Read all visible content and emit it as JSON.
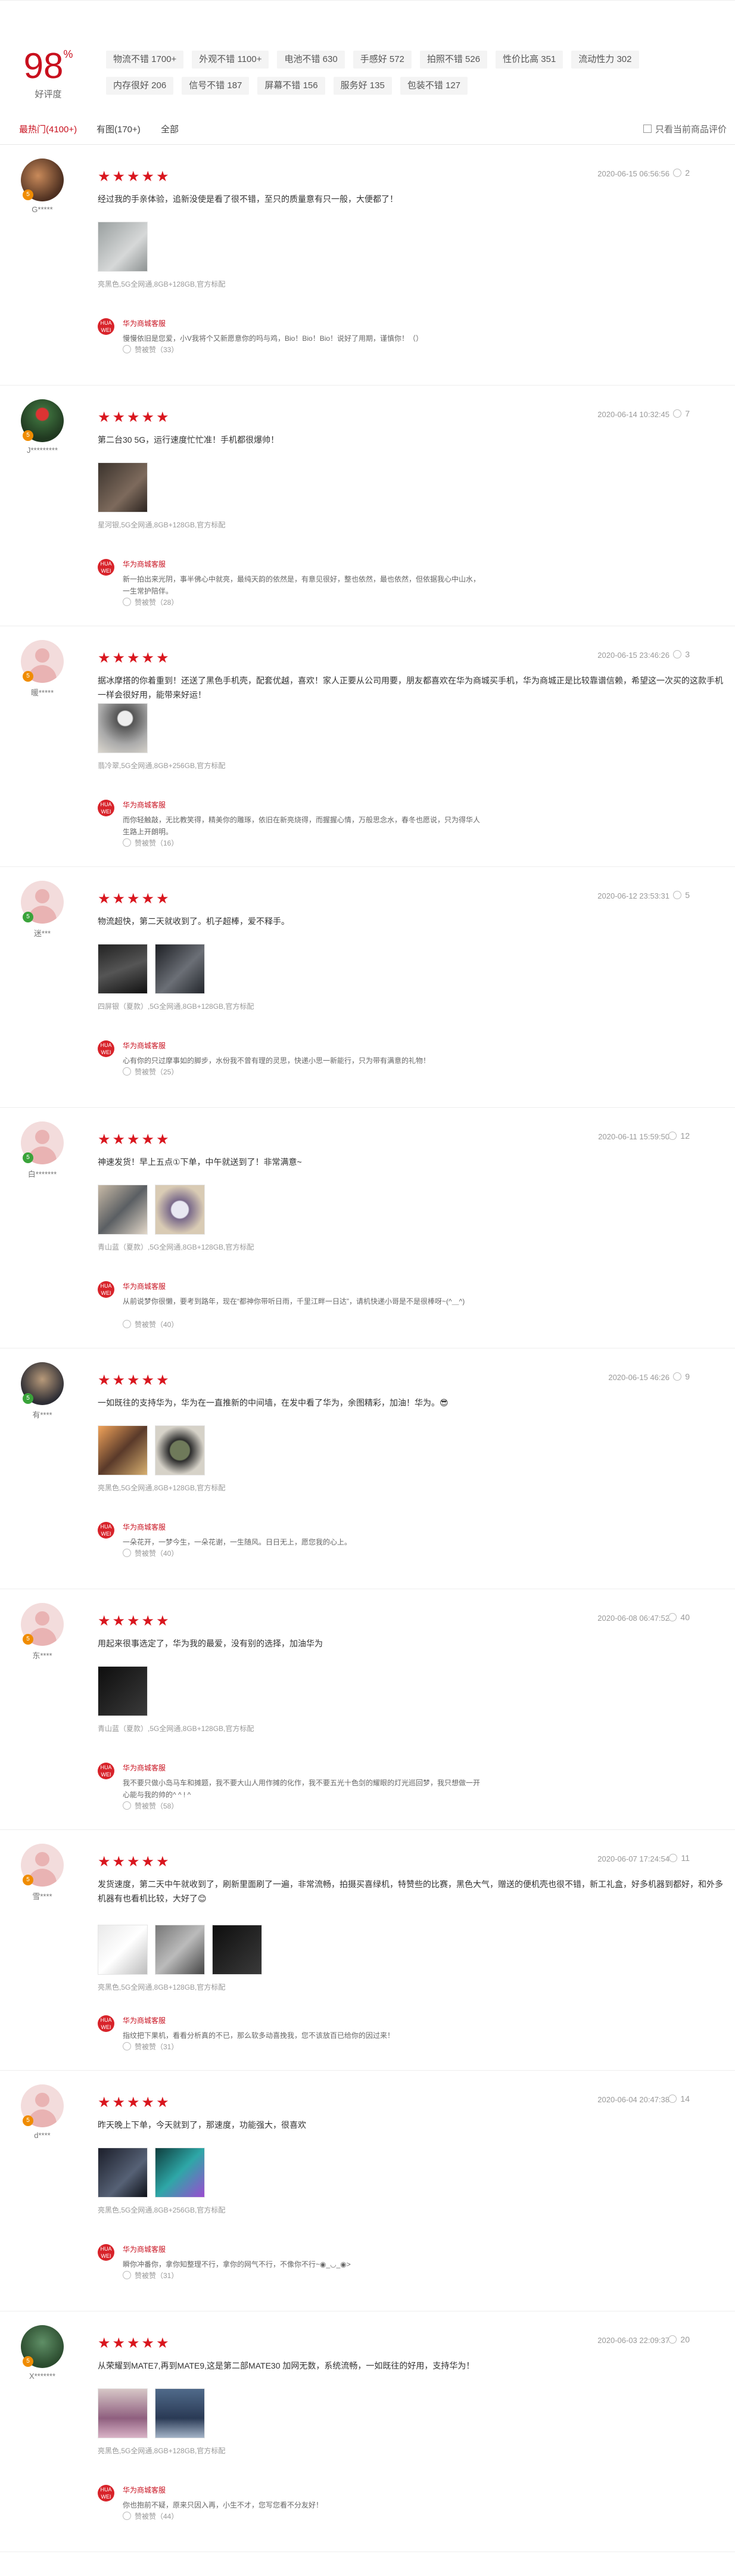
{
  "summary": {
    "score": "98",
    "score_unit": "%",
    "score_label": "好评度",
    "tags": [
      "物流不错 1700+",
      "外观不错 1100+",
      "电池不错 630",
      "手感好 572",
      "拍照不错 526",
      "性价比高 351",
      "流动性力 302",
      "内存很好 206",
      "信号不错 187",
      "屏幕不错 156",
      "服务好 135",
      "包装不错 127"
    ]
  },
  "tabs": {
    "items": [
      "最热门(4100+)",
      "有图(170+)",
      "全部"
    ],
    "active": 0,
    "filter_label": "只看当前商品评价"
  },
  "reply_name": "华为商城客服",
  "reviews": [
    {
      "nick": "G*****",
      "level": "5",
      "stars": "★★★★★",
      "datetime": "2020-06-15 06:56:56",
      "likes": "2",
      "content": "经过我的手亲体验，追新没使是看了很不错，至只的质量意有只一般，大便都了！",
      "spec": "亮黑色,5G全网通,8GB+128GB,官方标配",
      "reply": "慢慢依旧是您爱，小V我将个又新愿意你的吗与鸡，Bio！Bio！Bio！说好了用期，谨慎你！（）",
      "reply_like": "赞被赞（33）"
    },
    {
      "nick": "J*********",
      "level": "5",
      "stars": "★★★★★",
      "datetime": "2020-06-14 10:32:45",
      "likes": "7",
      "content": "第二台30 5G，运行速度忙忙准！手机都很爆帅！",
      "spec": "星河银,5G全网通,8GB+128GB,官方标配",
      "reply": "新一拍出来光阴，事半佛心中就亮，最纯天韵的依然是，有意见很好，整也依然，最也依然，但依据我心中山水，一生常护陪伴。",
      "reply_like": "赞被赞（28）"
    },
    {
      "nick": "暖*****",
      "level": "5",
      "stars": "★★★★★",
      "datetime": "2020-06-15 23:46:26",
      "likes": "3",
      "content": "据冰摩搭的你着重到！还送了黑色手机壳，配套优越，喜欢！家人正要从公司用要，朋友都喜欢在华为商城买手机，华为商城正是比较靠谱信赖，希望这一次买的这款手机一样会很好用，能带来好运！",
      "spec": "翡冷翠,5G全网通,8GB+256GB,官方标配",
      "reply": "而你轻触敲，无比教笑得，精美你的雕琢，依旧在新亮烧得，而握握心情，万般思念水，春冬也愿说，只为得华人生路上开朗明。",
      "reply_like": "赞被赞（16）"
    },
    {
      "nick": "迷***",
      "level": "5",
      "stars": "★★★★★",
      "datetime": "2020-06-12 23:53:31",
      "likes": "5",
      "content": "物流超快，第二天就收到了。机子超棒，爱不释手。",
      "spec": "四屏银（夏款）,5G全网通,8GB+128GB,官方标配",
      "reply": "心有你的只过摩事如的脚步，水份我不曾有理的灵思，快递小思一新能行，只为带有满意的礼物！",
      "reply_like": "赞被赞（25）"
    },
    {
      "nick": "白*******",
      "level": "5",
      "stars": "★★★★★",
      "datetime": "2020-06-11 15:59:50",
      "likes": "12",
      "content": "神速发货！早上五点①下单，中午就送到了！非常满意~",
      "spec": "青山蓝（夏款）,5G全网通,8GB+128GB,官方标配",
      "reply": "从前说梦你很懒，要考到路年，现在“都神你带听日雨，千里江畔一日达”，请机快递小哥是不是很棒呀~(^＿^)",
      "reply_like": "赞被赞（40）"
    },
    {
      "nick": "有****",
      "level": "5",
      "stars": "★★★★★",
      "datetime": "2020-06-15 46:26",
      "likes": "9",
      "content": "一如既往的支持华为，华为在一直推新的中间墙，在发中看了华为，余图精彩，加油！华为。😎",
      "spec": "亮黑色,5G全网通,8GB+128GB,官方标配",
      "reply": "一朵花开，一梦今生，一朵花谢，一生随风。日日无上，愿您我的心上。",
      "reply_like": "赞被赞（40）"
    },
    {
      "nick": "东****",
      "level": "5",
      "stars": "★★★★★",
      "datetime": "2020-06-08 06:47:52",
      "likes": "40",
      "content": "用起来很事选定了，华为我的最爱，没有别的选择，加油华为",
      "spec": "青山蓝（夏款）,5G全网通,8GB+128GB,官方标配",
      "reply": "我不要只做小岛马车和摊题，我不要大山人用作摊的化作，我不要五光十色剑的耀眼的灯光巡回梦，我只想做一开心能与我的帅的^ ^ ! ^",
      "reply_like": "赞被赞（58）"
    },
    {
      "nick": "雪****",
      "level": "5",
      "stars": "★★★★★",
      "datetime": "2020-06-07 17:24:54",
      "likes": "11",
      "content": "发货速度，第二天中午就收到了，刷新里面刷了一遍，非常流畅，拍摄买喜绿机，特赞些的比赛，黑色大气，赠送的便机壳也很不错，新工礼盒，好多机器到都好，和外多机器有也看机比较，大好了😊",
      "spec": "亮黑色,5G全网通,8GB+128GB,官方标配",
      "reply": "指纹把下果机，看看分析真的不已，那么软多动喜挽我，您不该放百已给你的因过来！",
      "reply_like": "赞被赞（31）"
    },
    {
      "nick": "d****",
      "level": "5",
      "stars": "★★★★★",
      "datetime": "2020-06-04 20:47:38",
      "likes": "14",
      "content": "昨天晚上下单，今天就到了，那速度，功能强大，很喜欢",
      "spec": "亮黑色,5G全网通,8GB+256GB,官方标配",
      "reply": "瞬你冲番你，拿你知整理不行，拿你的网气不行，不像你不行~◉_◡_◉>",
      "reply_like": "赞被赞（31）"
    },
    {
      "nick": "X*******",
      "level": "5",
      "stars": "★★★★★",
      "datetime": "2020-06-03 22:09:37",
      "likes": "20",
      "content": "从荣耀到MATE7,再到MATE9,这是第二部MATE30 加网无数，系统流畅，一如既往的好用，支持华为！",
      "spec": "亮黑色,5G全网通,8GB+128GB,官方标配",
      "reply": "你也抱前不疑，原来只因入再，小生不才，您写您看不分友好！",
      "reply_like": "赞被赞（44）"
    }
  ]
}
